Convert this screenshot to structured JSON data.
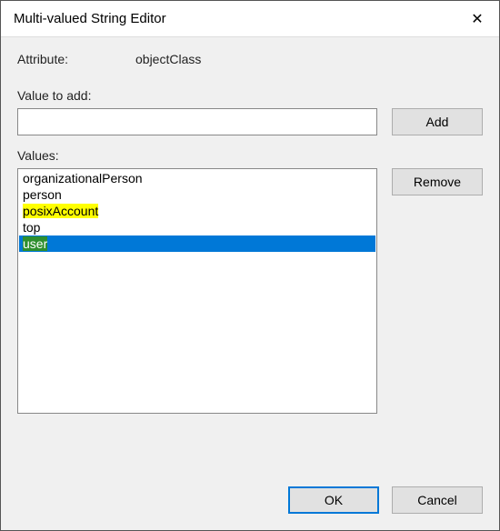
{
  "window": {
    "title": "Multi-valued String Editor",
    "close_glyph": "✕"
  },
  "attribute": {
    "label": "Attribute:",
    "value": "objectClass"
  },
  "addSection": {
    "label": "Value to add:",
    "input_value": "",
    "button_label": "Add"
  },
  "valuesSection": {
    "label": "Values:",
    "remove_label": "Remove",
    "items": [
      {
        "text": "organizationalPerson",
        "highlight": "none",
        "selected": false
      },
      {
        "text": "person",
        "highlight": "none",
        "selected": false
      },
      {
        "text": "posixAccount",
        "highlight": "yellow",
        "selected": false
      },
      {
        "text": "top",
        "highlight": "none",
        "selected": false
      },
      {
        "text": "user",
        "highlight": "green",
        "selected": true
      }
    ]
  },
  "footer": {
    "ok_label": "OK",
    "cancel_label": "Cancel"
  }
}
